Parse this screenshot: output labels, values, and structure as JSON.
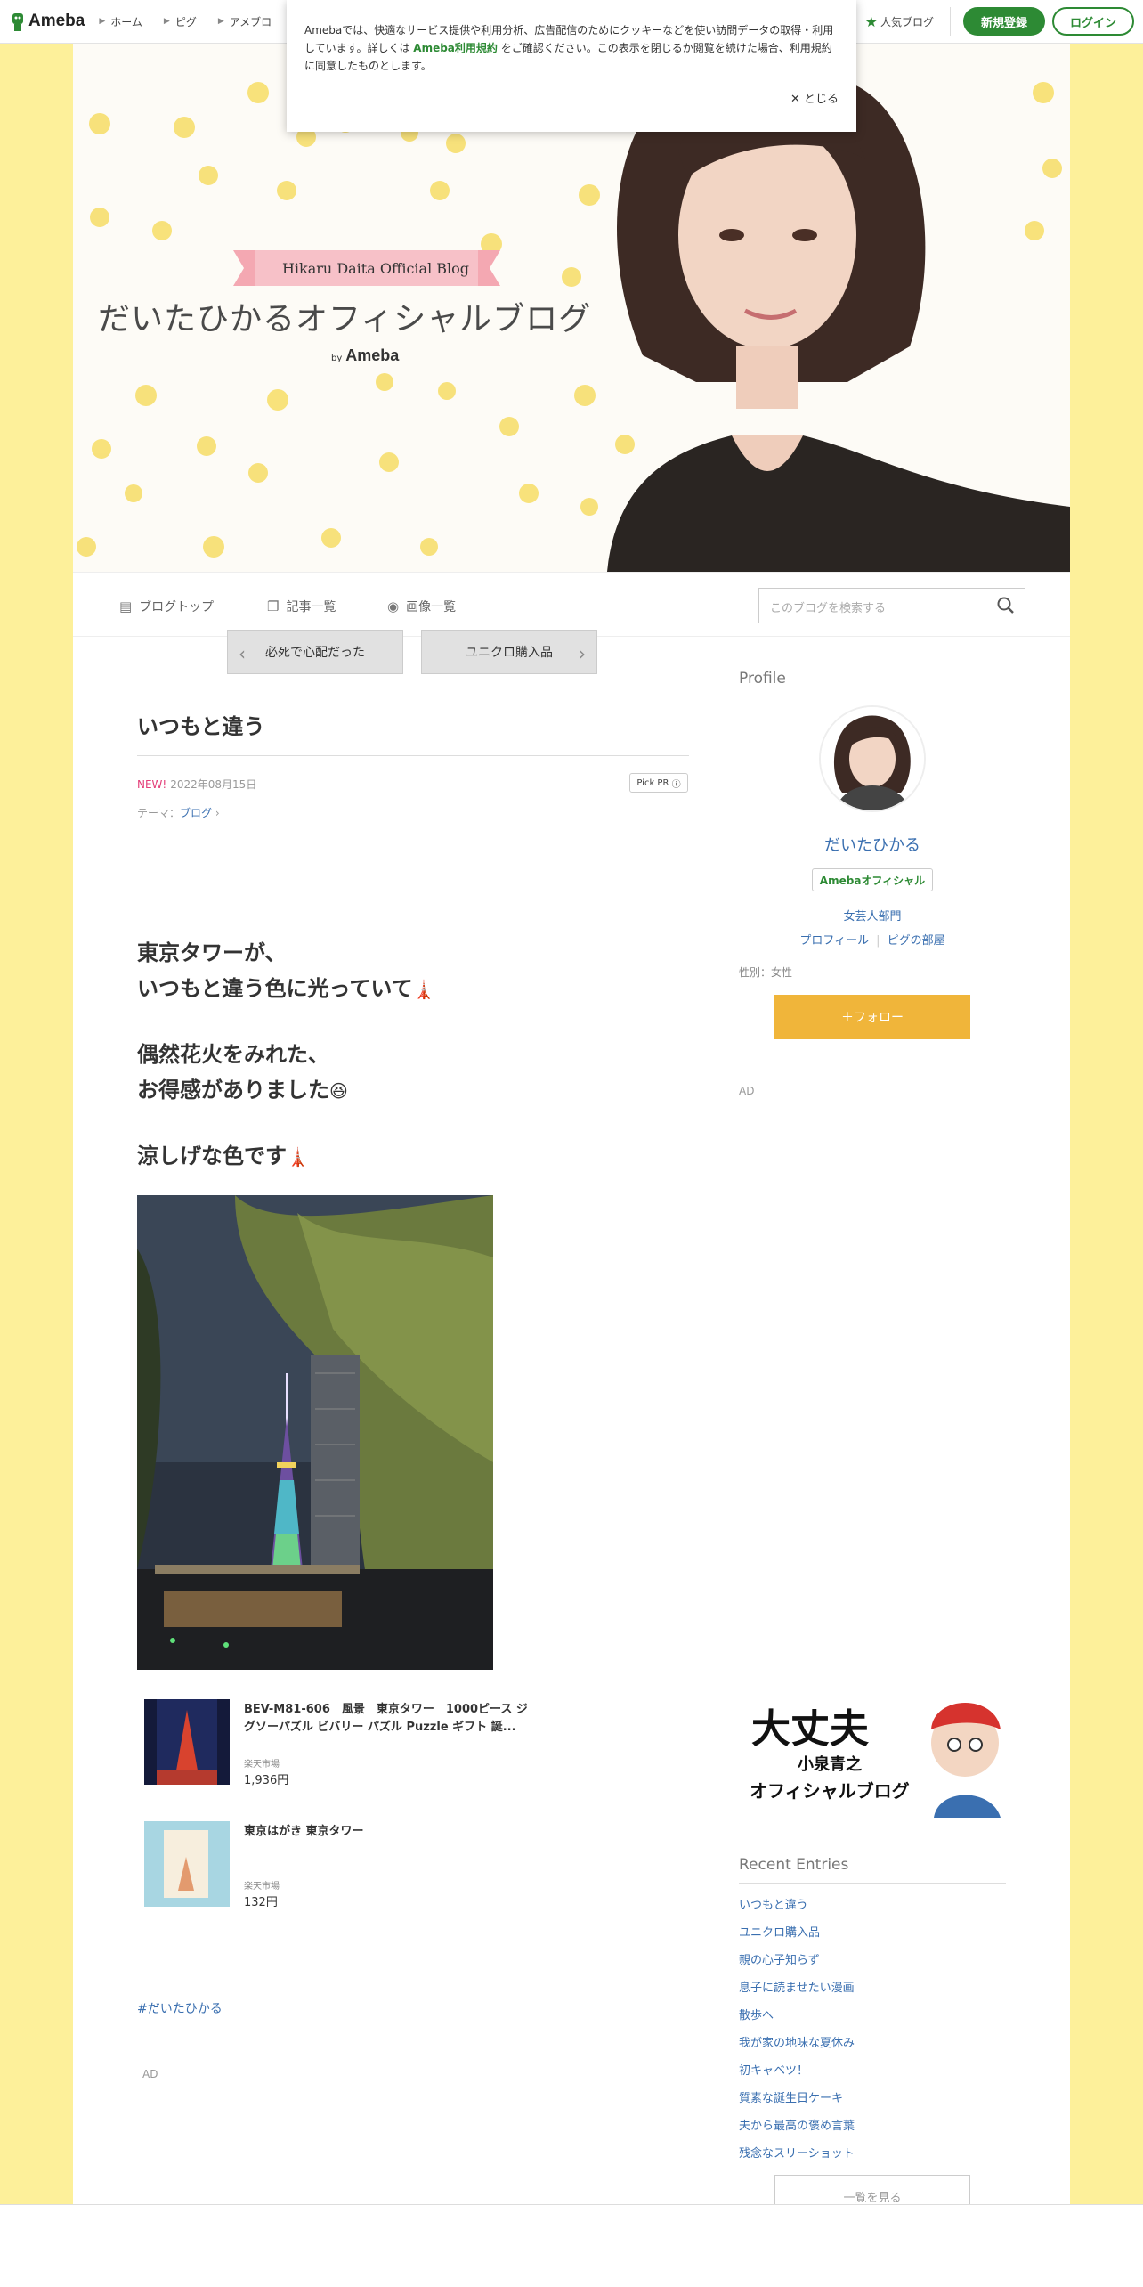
{
  "header": {
    "logo": "Ameba",
    "nav": [
      "ホーム",
      "ピグ",
      "アメブロ"
    ],
    "popular": "人気ブログ",
    "register": "新規登録",
    "login": "ログイン"
  },
  "cookie": {
    "text_before": "Amebaでは、快適なサービス提供や利用分析、広告配信のためにクッキーなどを使い訪問データの取得・利用しています。詳しくは",
    "link": "Ameba利用規約",
    "text_after": "をご確認ください。この表示を閉じるか閲覧を続けた場合、利用規約に同意したものとします。",
    "close": "とじる"
  },
  "hero": {
    "ribbon": "Hikaru Daita Official Blog",
    "title": "だいたひかるオフィシャルブログ",
    "by": "by",
    "brand": "Ameba"
  },
  "blognav": {
    "top": "ブログトップ",
    "list": "記事一覧",
    "images": "画像一覧",
    "search_placeholder": "このブログを検索する"
  },
  "pager": {
    "prev": "必死で心配だった",
    "next": "ユニクロ購入品"
  },
  "entry": {
    "title": "いつもと違う",
    "new": "NEW!",
    "date": "2022年08月15日",
    "pickpr": "Pick PR",
    "theme_label": "テーマ：",
    "theme": "ブログ",
    "lines": [
      "東京タワーが、",
      "いつもと違う色に光っていて",
      "偶然花火をみれた、",
      "お得感がありました",
      "涼しげな色です"
    ],
    "hashtag": "#だいたひかる",
    "ad": "AD"
  },
  "products": [
    {
      "name": "BEV-M81-606　風景　東京タワー　1000ピース ジグソーパズル ビバリー パズル Puzzle ギフト 誕...",
      "store": "楽天市場",
      "price": "1,936円"
    },
    {
      "name": "東京はがき 東京タワー",
      "store": "楽天市場",
      "price": "132円"
    }
  ],
  "sidebar": {
    "profile_title": "Profile",
    "name": "だいたひかる",
    "official": "Amebaオフィシャル",
    "genre": "女芸人部門",
    "profile_link": "プロフィール",
    "pig_link": "ピグの部屋",
    "gender": "性別：女性",
    "follow": "＋フォロー",
    "ad": "AD",
    "banner_line1": "大丈夫",
    "banner_line2": "小泉青之",
    "banner_line3": "オフィシャルブログ",
    "recent_title": "Recent Entries",
    "recent": [
      "いつもと違う",
      "ユニクロ購入品",
      "親の心子知らず",
      "息子に読ませたい漫画",
      "散歩へ",
      "我が家の地味な夏休み",
      "初キャベツ！",
      "質素な誕生日ケーキ",
      "夫から最高の褒め言葉",
      "残念なスリーショット"
    ],
    "see_all": "一覧を見る"
  }
}
